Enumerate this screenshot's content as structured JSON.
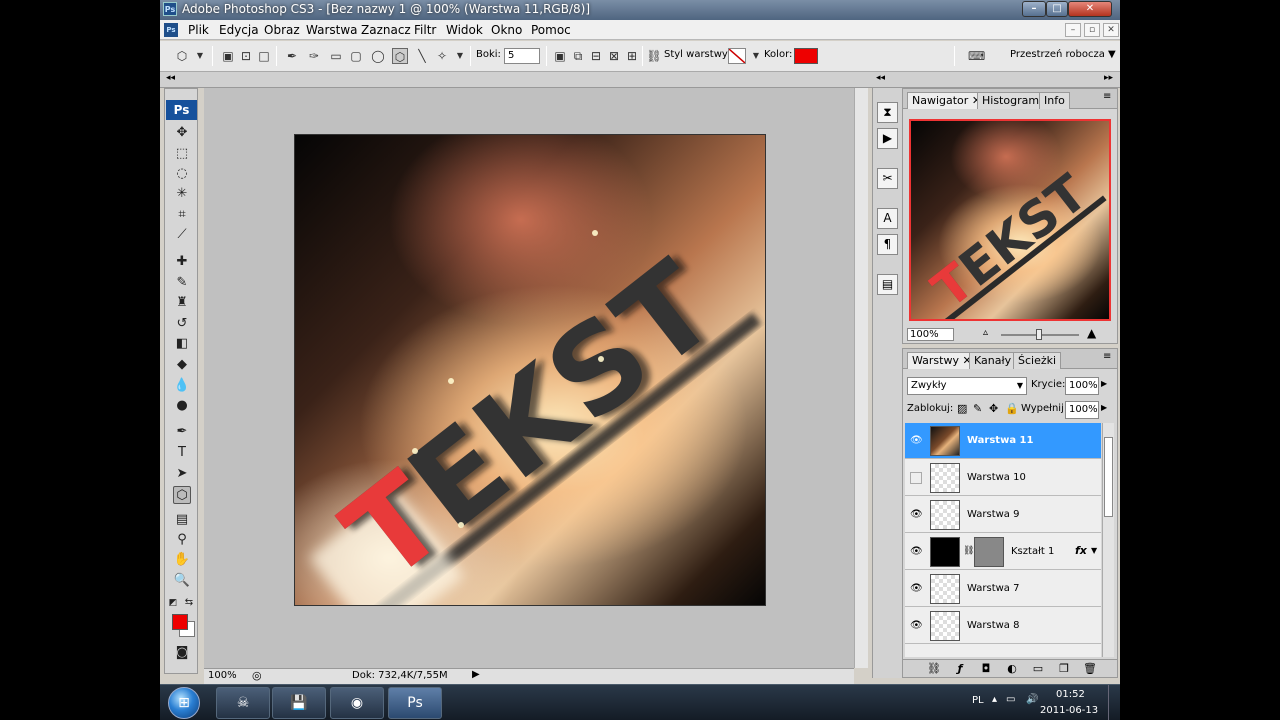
{
  "window": {
    "title": "Adobe Photoshop CS3 - [Bez nazwy 1 @ 100% (Warstwa 11,RGB/8)]",
    "controls": {
      "minimize": "–",
      "maximize": "□",
      "close": "✕"
    }
  },
  "menu": {
    "logo": "Ps",
    "items": [
      "Plik",
      "Edycja",
      "Obraz",
      "Warstwa",
      "Zaznacz",
      "Filtr",
      "Widok",
      "Okno",
      "Pomoc"
    ],
    "doc_controls": {
      "minimize": "–",
      "restore": "▫",
      "close": "✕"
    }
  },
  "options": {
    "sides_label": "Boki:",
    "sides_value": "5",
    "style_label": "Styl warstwy:",
    "color_label": "Kolor:",
    "color_value": "#ee0000",
    "workspace_label": "Przestrzeń robocza ▼"
  },
  "tools": {
    "logo": "Ps"
  },
  "canvas": {
    "text": "TEKST"
  },
  "status": {
    "zoom": "100%",
    "doc_info": "Dok: 732,4K/7,55M"
  },
  "navigator": {
    "tabs": [
      "Nawigator",
      "Histogram",
      "Info"
    ],
    "zoom": "100%",
    "thumb_text": "TEKST"
  },
  "layers": {
    "tabs": [
      "Warstwy",
      "Kanały",
      "Ścieżki"
    ],
    "blend_mode": "Zwykły",
    "opacity_label": "Krycie:",
    "opacity_value": "100%",
    "lock_label": "Zablokuj:",
    "fill_label": "Wypełnij:",
    "fill_value": "100%",
    "items": [
      {
        "name": "Warstwa 11",
        "visible": true,
        "selected": true
      },
      {
        "name": "Warstwa 10",
        "visible": false,
        "selected": false
      },
      {
        "name": "Warstwa 9",
        "visible": true,
        "selected": false
      },
      {
        "name": "Kształt 1",
        "visible": true,
        "selected": false,
        "fx": "fx"
      },
      {
        "name": "Warstwa 7",
        "visible": true,
        "selected": false
      },
      {
        "name": "Warstwa 8",
        "visible": true,
        "selected": false
      }
    ]
  },
  "taskbar": {
    "language": "PL",
    "time": "01:52",
    "date": "2011-06-13",
    "ps_button": "Ps"
  }
}
